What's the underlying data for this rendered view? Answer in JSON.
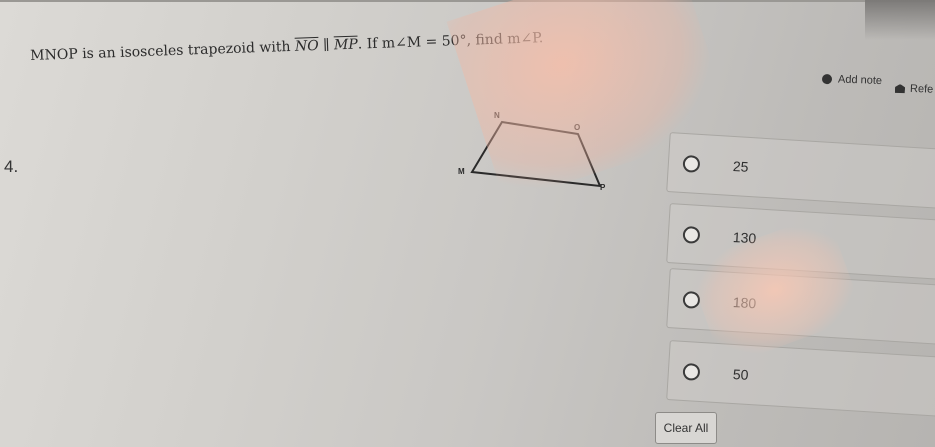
{
  "question": {
    "number": "4.",
    "prefix": "MNOP is an isosceles trapezoid with ",
    "seg1": "NO",
    "parallel": " ∥ ",
    "seg2": "MP",
    "suffix": ". If m∠M = 50°, find m∠P."
  },
  "figure": {
    "labels": {
      "n": "N",
      "o": "O",
      "m": "M",
      "p": "P"
    }
  },
  "toolbar": {
    "add_note": "Add note",
    "reference": "Refe"
  },
  "choices": [
    {
      "label": "25"
    },
    {
      "label": "130"
    },
    {
      "label": "180"
    },
    {
      "label": "50"
    }
  ],
  "clear_all": "Clear All",
  "colors": {
    "glare": "#f2bca8",
    "border": "#a9a7a3"
  },
  "icons": {
    "add_note": "circle-icon",
    "reference": "hat-icon",
    "choice": "radio-icon"
  }
}
